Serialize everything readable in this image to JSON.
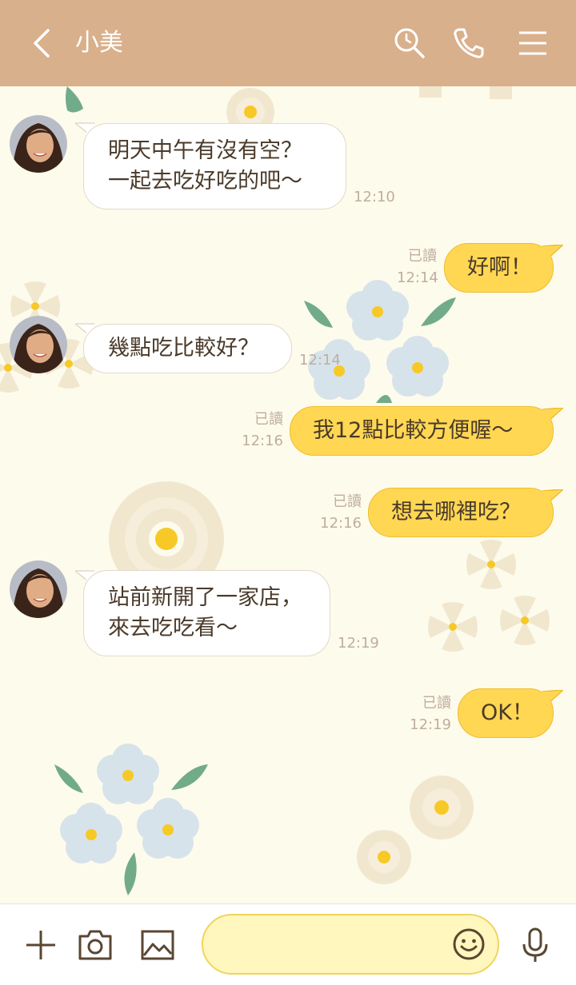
{
  "header": {
    "title": "小美",
    "background": "#d9b08c"
  },
  "messages": [
    {
      "side": "in",
      "lines": [
        "明天中午有沒有空？",
        "一起去吃好吃的吧～"
      ],
      "time": "12:10"
    },
    {
      "side": "out",
      "text": "好啊！",
      "read": "已讀",
      "time": "12:14"
    },
    {
      "side": "in",
      "lines": [
        "幾點吃比較好？"
      ],
      "time": "12:14"
    },
    {
      "side": "out",
      "text": "我12點比較方便喔～",
      "read": "已讀",
      "time": "12:16"
    },
    {
      "side": "out",
      "text": "想去哪裡吃？",
      "read": "已讀",
      "time": "12:16"
    },
    {
      "side": "in",
      "lines": [
        "站前新開了一家店，",
        "來去吃吃看～"
      ],
      "time": "12:19"
    },
    {
      "side": "out",
      "text": "OK！",
      "read": "已讀",
      "time": "12:19"
    }
  ],
  "footer": {
    "input_placeholder": ""
  },
  "colors": {
    "outgoing_bubble": "#ffd753",
    "incoming_bubble": "#ffffff",
    "chat_background": "#fdfbec"
  },
  "icons": [
    "back-chevron-icon",
    "search-icon",
    "phone-icon",
    "menu-icon",
    "plus-icon",
    "camera-icon",
    "image-icon",
    "emoji-icon",
    "microphone-icon"
  ]
}
